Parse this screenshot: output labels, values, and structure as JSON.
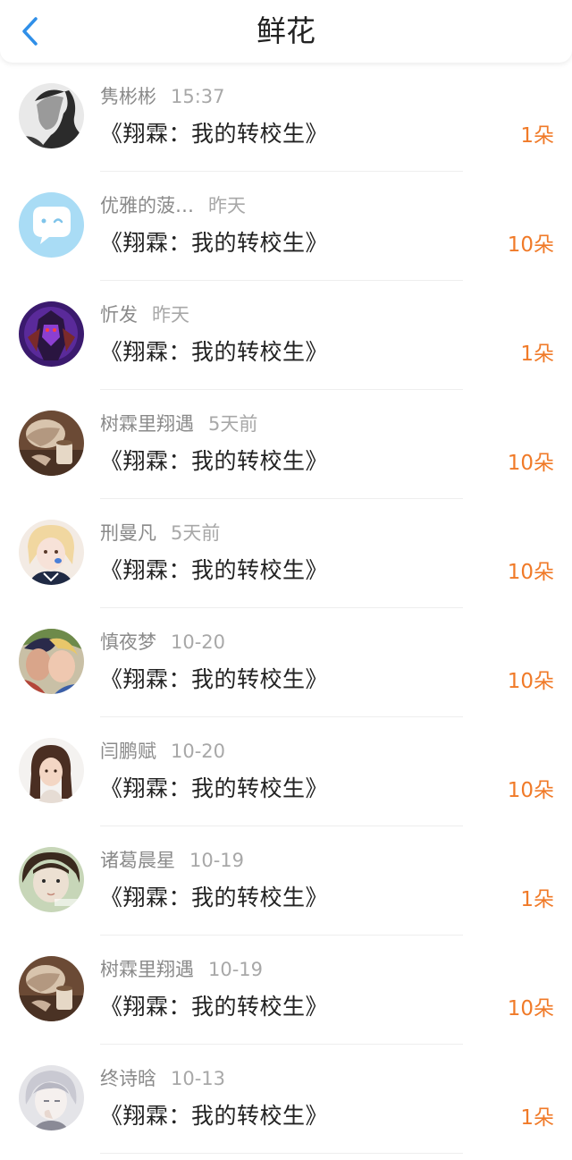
{
  "header": {
    "title": "鲜花",
    "back_icon": "chevron-left-icon",
    "accent_color": "#2f8fe8"
  },
  "items": [
    {
      "name": "隽彬彬",
      "time": "15:37",
      "book": "《翔霖：我的转校生》",
      "count": "1朵",
      "avatar": "avatar-icon"
    },
    {
      "name": "优雅的菠…",
      "time": "昨天",
      "book": "《翔霖：我的转校生》",
      "count": "10朵",
      "avatar": "chat-bubble-icon"
    },
    {
      "name": "忻发",
      "time": "昨天",
      "book": "《翔霖：我的转校生》",
      "count": "1朵",
      "avatar": "avatar-icon"
    },
    {
      "name": "树霖里翔遇",
      "time": "5天前",
      "book": "《翔霖：我的转校生》",
      "count": "10朵",
      "avatar": "avatar-icon"
    },
    {
      "name": "刑曼凡",
      "time": "5天前",
      "book": "《翔霖：我的转校生》",
      "count": "10朵",
      "avatar": "avatar-icon"
    },
    {
      "name": "慎夜梦",
      "time": "10-20",
      "book": "《翔霖：我的转校生》",
      "count": "10朵",
      "avatar": "avatar-icon"
    },
    {
      "name": "闫鹏赋",
      "time": "10-20",
      "book": "《翔霖：我的转校生》",
      "count": "10朵",
      "avatar": "avatar-icon"
    },
    {
      "name": "诸葛晨星",
      "time": "10-19",
      "book": "《翔霖：我的转校生》",
      "count": "1朵",
      "avatar": "avatar-icon"
    },
    {
      "name": "树霖里翔遇",
      "time": "10-19",
      "book": "《翔霖：我的转校生》",
      "count": "10朵",
      "avatar": "avatar-icon"
    },
    {
      "name": "终诗晗",
      "time": "10-13",
      "book": "《翔霖：我的转校生》",
      "count": "1朵",
      "avatar": "avatar-icon"
    }
  ],
  "colors": {
    "count": "#f07a28",
    "name": "#8a8a8a",
    "book": "#222222"
  }
}
